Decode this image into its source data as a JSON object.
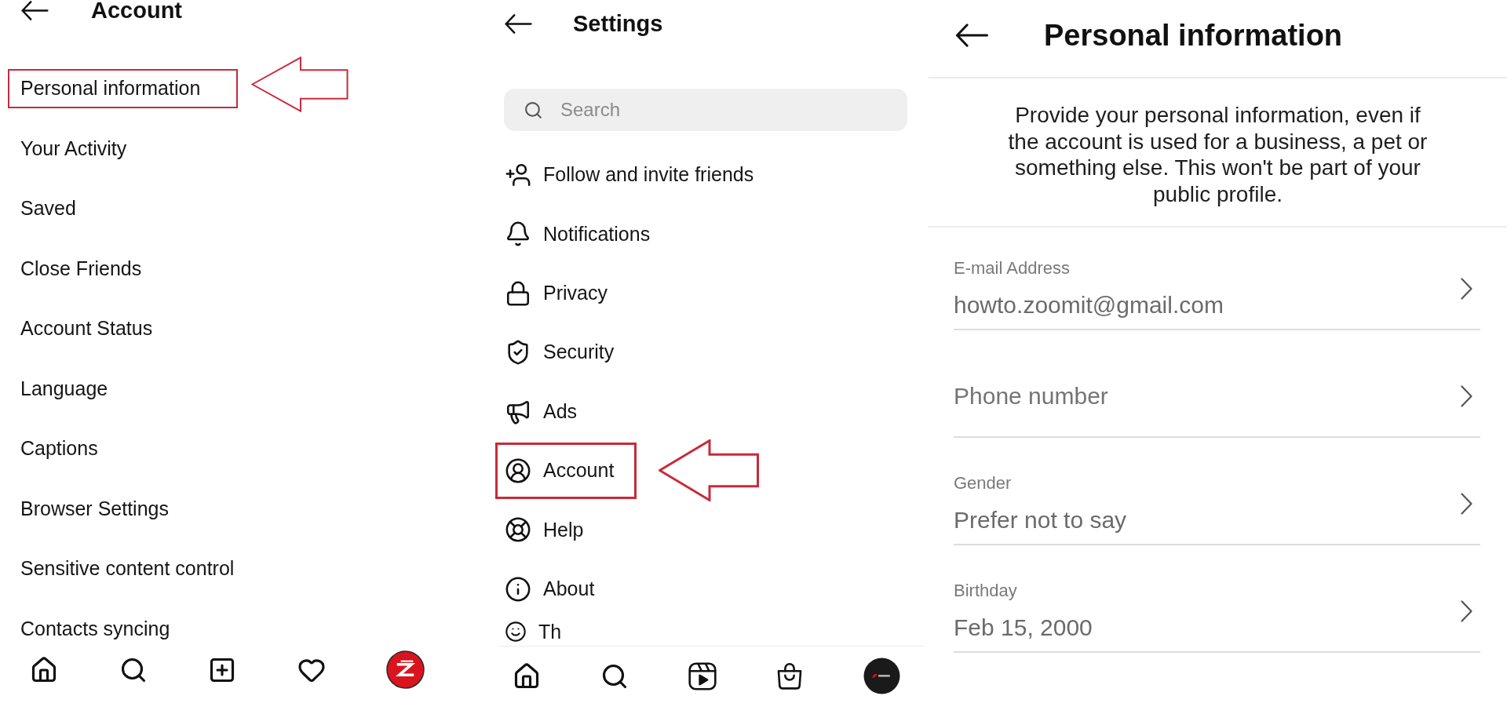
{
  "account_screen": {
    "title": "Account",
    "items": [
      {
        "label": "Personal information",
        "highlighted": true
      },
      {
        "label": "Your Activity",
        "highlighted": false
      },
      {
        "label": "Saved",
        "highlighted": false
      },
      {
        "label": "Close Friends",
        "highlighted": false
      },
      {
        "label": "Account Status",
        "highlighted": false
      },
      {
        "label": "Language",
        "highlighted": false
      },
      {
        "label": "Captions",
        "highlighted": false
      },
      {
        "label": "Browser Settings",
        "highlighted": false
      },
      {
        "label": "Sensitive content control",
        "highlighted": false
      },
      {
        "label": "Contacts syncing",
        "highlighted": false
      }
    ]
  },
  "settings_screen": {
    "title": "Settings",
    "search": {
      "placeholder": "Search"
    },
    "items": [
      {
        "label": "Follow and invite friends",
        "highlighted": false,
        "cut_off": false
      },
      {
        "label": "Notifications",
        "highlighted": false,
        "cut_off": false
      },
      {
        "label": "Privacy",
        "highlighted": false,
        "cut_off": false
      },
      {
        "label": "Security",
        "highlighted": false,
        "cut_off": false
      },
      {
        "label": "Ads",
        "highlighted": false,
        "cut_off": false
      },
      {
        "label": "Account",
        "highlighted": true,
        "cut_off": false
      },
      {
        "label": "Help",
        "highlighted": false,
        "cut_off": false
      },
      {
        "label": "About",
        "highlighted": false,
        "cut_off": false
      },
      {
        "label": "Th",
        "highlighted": false,
        "cut_off": true
      }
    ]
  },
  "personal_information_screen": {
    "title": "Personal information",
    "description": "Provide your personal information, even if the account is used for a business, a pet or something else. This won't be part of your public profile.",
    "fields": [
      {
        "label": "E-mail Address",
        "value": "howto.zoomit@gmail.com"
      },
      {
        "placeholder": "Phone number"
      },
      {
        "label": "Gender",
        "value": "Prefer not to say"
      },
      {
        "label": "Birthday",
        "value": "Feb 15, 2000"
      }
    ]
  }
}
